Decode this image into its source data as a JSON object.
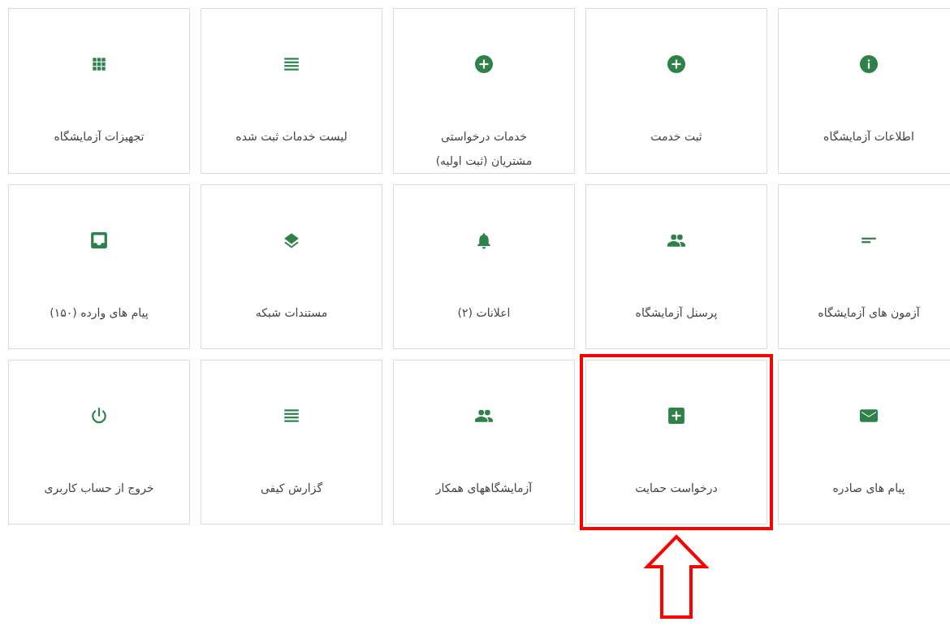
{
  "tiles": [
    {
      "label": "اطلاعات آزمایشگاه",
      "highlighted": false
    },
    {
      "label": "ثبت خدمت",
      "highlighted": false
    },
    {
      "label": "خدمات درخواستی مشتریان (ثبت اولیه)",
      "highlighted": false
    },
    {
      "label": "لیست خدمات ثبت شده",
      "highlighted": false
    },
    {
      "label": "تجهیزات آزمایشگاه",
      "highlighted": false
    },
    {
      "label": "آزمون های آزمایشگاه",
      "highlighted": false
    },
    {
      "label": "پرسنل آزمایشگاه",
      "highlighted": false
    },
    {
      "label": "اعلانات (۲)",
      "highlighted": false
    },
    {
      "label": "مستندات شبکه",
      "highlighted": false
    },
    {
      "label": "پیام های وارده (۱۵۰)",
      "highlighted": false
    },
    {
      "label": "پیام های صادره",
      "highlighted": false
    },
    {
      "label": "درخواست حمایت",
      "highlighted": true
    },
    {
      "label": "آزمایشگاههای همکار",
      "highlighted": false
    },
    {
      "label": "گزارش کیفی",
      "highlighted": false
    },
    {
      "label": "خروج از حساب کاربری",
      "highlighted": false
    }
  ]
}
